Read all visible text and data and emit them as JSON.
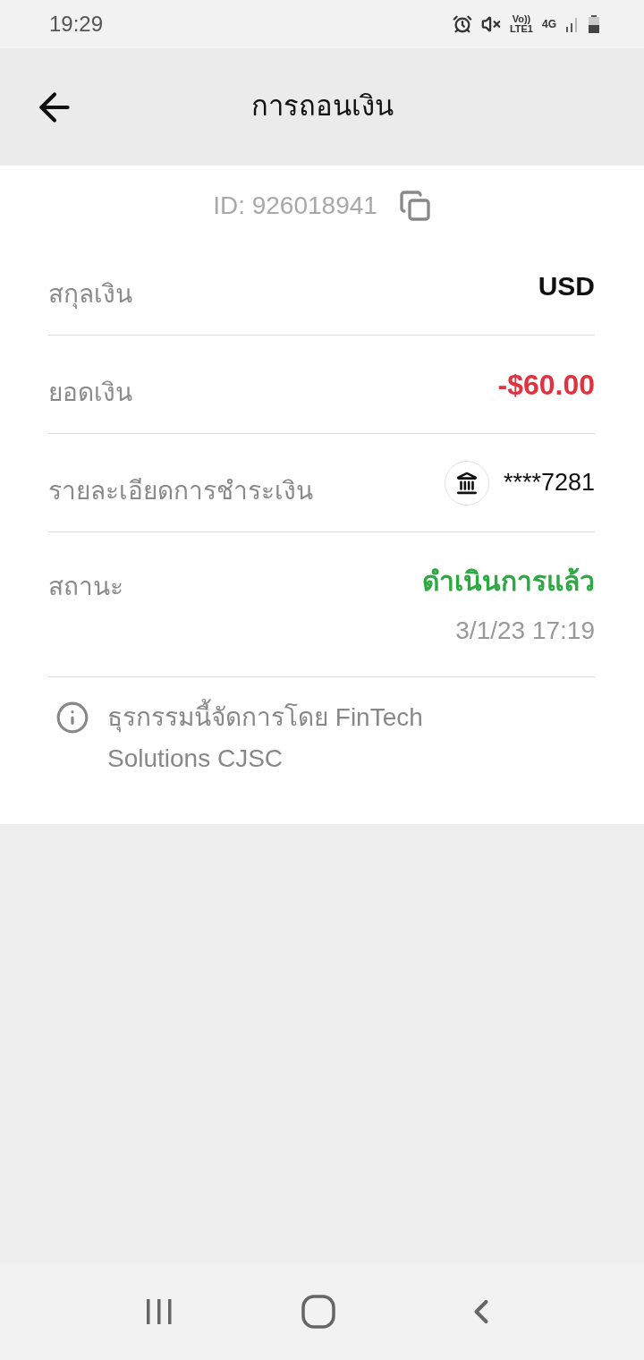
{
  "status_bar": {
    "time": "19:29",
    "volte": "Vo))",
    "lte": "LTE1",
    "network": "4G"
  },
  "header": {
    "title": "การถอนเงิน"
  },
  "transaction": {
    "id": "ID: 926018941",
    "rows": [
      {
        "kind": "plain",
        "label": "สกุลเงิน",
        "value": "USD"
      },
      {
        "kind": "amount",
        "label": "ยอดเงิน",
        "value": "-$60.00"
      },
      {
        "kind": "bank",
        "label": "รายละเอียดการชำระเงิน",
        "value": "****7281"
      },
      {
        "kind": "status",
        "label": "สถานะ",
        "value": "ดำเนินการแล้ว",
        "date": "3/1/23 17:19"
      }
    ],
    "note": "ธุรกรรมนี้จัดการโดย FinTech Solutions CJSC"
  }
}
